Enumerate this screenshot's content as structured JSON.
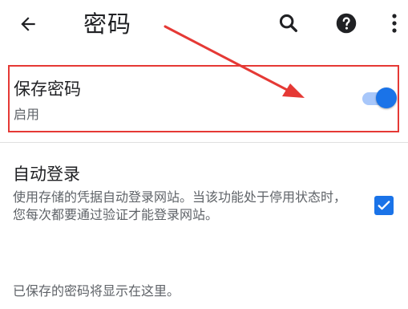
{
  "appbar": {
    "title": "密码",
    "back_icon": "arrow-back-icon",
    "search_icon": "search-icon",
    "help_icon": "help-icon",
    "more_icon": "more-vert-icon"
  },
  "save_passwords": {
    "title": "保存密码",
    "status": "启用",
    "toggle_on": true
  },
  "auto_signin": {
    "title": "自动登录",
    "description": "使用存储的凭据自动登录网站。当该功能处于停用状态时，您每次都要通过验证才能登录网站。",
    "checked": true
  },
  "empty_message": "已保存的密码将显示在这里。",
  "colors": {
    "accent": "#1a73e8",
    "toggle_track": "#a8c7fa",
    "highlight_border": "#e53935",
    "annotation_arrow": "#e53935"
  }
}
